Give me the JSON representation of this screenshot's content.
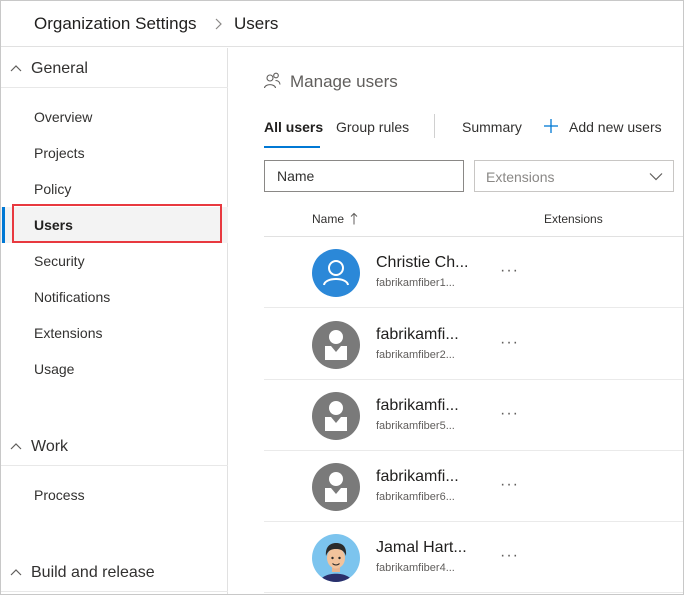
{
  "breadcrumb": {
    "root": "Organization Settings",
    "current": "Users"
  },
  "sidebar": {
    "groups": [
      {
        "title": "General",
        "items": [
          {
            "label": "Overview"
          },
          {
            "label": "Projects"
          },
          {
            "label": "Policy"
          },
          {
            "label": "Users",
            "selected": true
          },
          {
            "label": "Security"
          },
          {
            "label": "Notifications"
          },
          {
            "label": "Extensions"
          },
          {
            "label": "Usage"
          }
        ]
      },
      {
        "title": "Work",
        "items": [
          {
            "label": "Process"
          }
        ]
      },
      {
        "title": "Build and release",
        "items": []
      }
    ]
  },
  "main": {
    "title": "Manage users",
    "tabs": {
      "all_users": "All users",
      "group_rules": "Group rules",
      "summary": "Summary",
      "add_new_users": "Add new users"
    },
    "filters": {
      "name_placeholder": "Name",
      "extensions_label": "Extensions"
    },
    "columns": {
      "name": "Name",
      "extensions": "Extensions"
    },
    "users": [
      {
        "name": "Christie Ch...",
        "email": "fabrikamfiber1...",
        "avatar": "person-outline-blue"
      },
      {
        "name": "fabrikamfi...",
        "email": "fabrikamfiber2...",
        "avatar": "placeholder-gray"
      },
      {
        "name": "fabrikamfi...",
        "email": "fabrikamfiber5...",
        "avatar": "placeholder-gray"
      },
      {
        "name": "fabrikamfi...",
        "email": "fabrikamfiber6...",
        "avatar": "placeholder-gray"
      },
      {
        "name": "Jamal Hart...",
        "email": "fabrikamfiber4...",
        "avatar": "photo-cartoon"
      }
    ],
    "more_label": "···"
  },
  "colors": {
    "accent": "#0078d4",
    "highlight": "#e8393f",
    "avatar_blue": "#2b88d8",
    "avatar_gray": "#7a7a7a"
  }
}
